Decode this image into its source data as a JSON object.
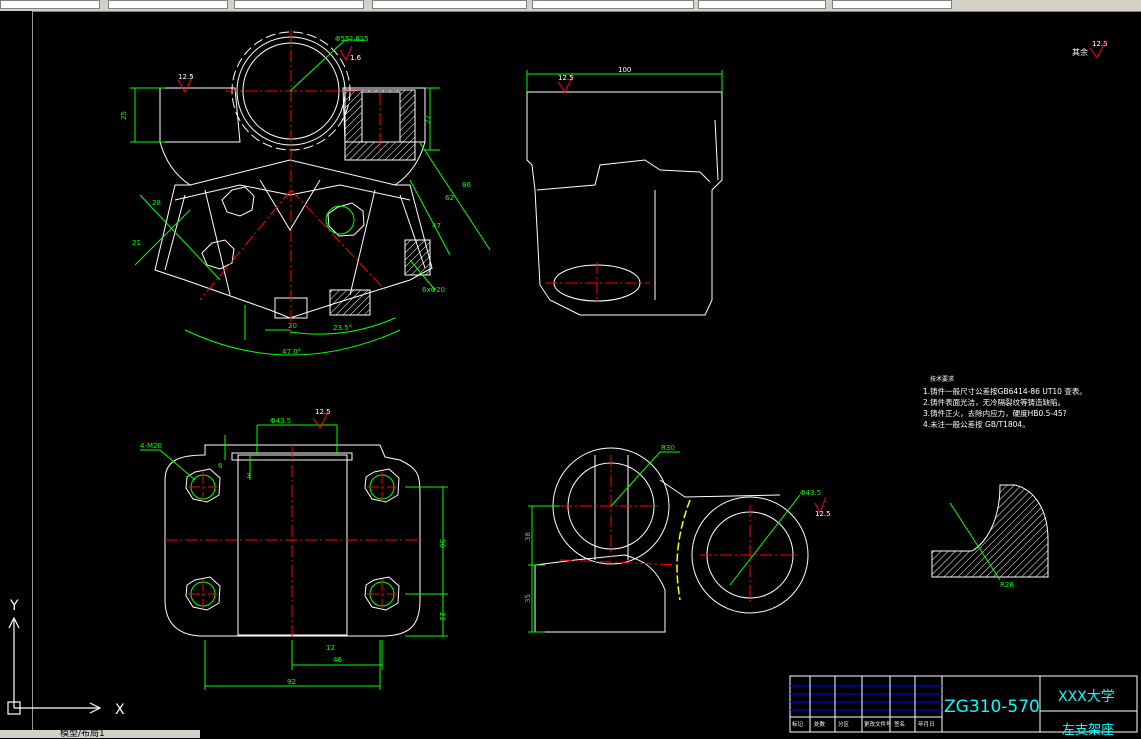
{
  "status_tabs": "模型/布局1",
  "ucs": {
    "x_label": "X",
    "y_label": "Y"
  },
  "colors": {
    "background": "#000000",
    "outline": "#ffffff",
    "dimension": "#00ff00",
    "centerline": "#ff0000",
    "yellow_line": "#ffff00",
    "titleblock_blue": "#0000ff",
    "label_cyan": "#00ffff"
  },
  "front_view": {
    "surface_mark": "12.5",
    "dia_label": "Φ55?.815",
    "dia_sub": "1.6",
    "dim_25": "25",
    "dim_27": "27",
    "dim_86": "86",
    "dim_62": "62",
    "dim_47": "47",
    "dim_28": "28",
    "dim_21": "21",
    "dim_20": "20",
    "hole_note": "6xΦ20",
    "angle_23": "23.5°",
    "angle_47": "47.0°"
  },
  "side_view": {
    "surface_mark": "12.5",
    "dim_100": "100"
  },
  "top_view": {
    "surface_mark": "12.5",
    "dia_label": "Φ43.5",
    "thread_note": "4-M20",
    "dim_56": "56",
    "dim_22": "22",
    "dim_12": "12",
    "dim_46": "46",
    "dim_92": "92",
    "dim_3": "3",
    "dim_6": "6"
  },
  "section_view": {
    "radius_label": "R30",
    "dia_label": "Φ43.5",
    "surface_mark": "12.5",
    "dim_38": "38",
    "dim_35": "35"
  },
  "detail": {
    "radius_label": "R26"
  },
  "roughness_note": {
    "text": "其余",
    "value": "12.5"
  },
  "tech_notes": {
    "heading": "技术要求",
    "lines": [
      "1.铸件一般尺寸公差按GB6414-86 UT10 查表。",
      "2.铸件表面光洁，无冷隔裂纹等铸造缺陷。",
      "3.铸件正火，去除内应力，硬度HB0.5-45?",
      "4.未注一般公差按 GB/T1804。"
    ]
  },
  "title_block": {
    "material": "ZG310-570",
    "university": "XXX大学",
    "name": "左支架座",
    "row_labels": [
      "标记",
      "处数",
      "分区",
      "更改文件号",
      "签名",
      "年月日"
    ]
  }
}
